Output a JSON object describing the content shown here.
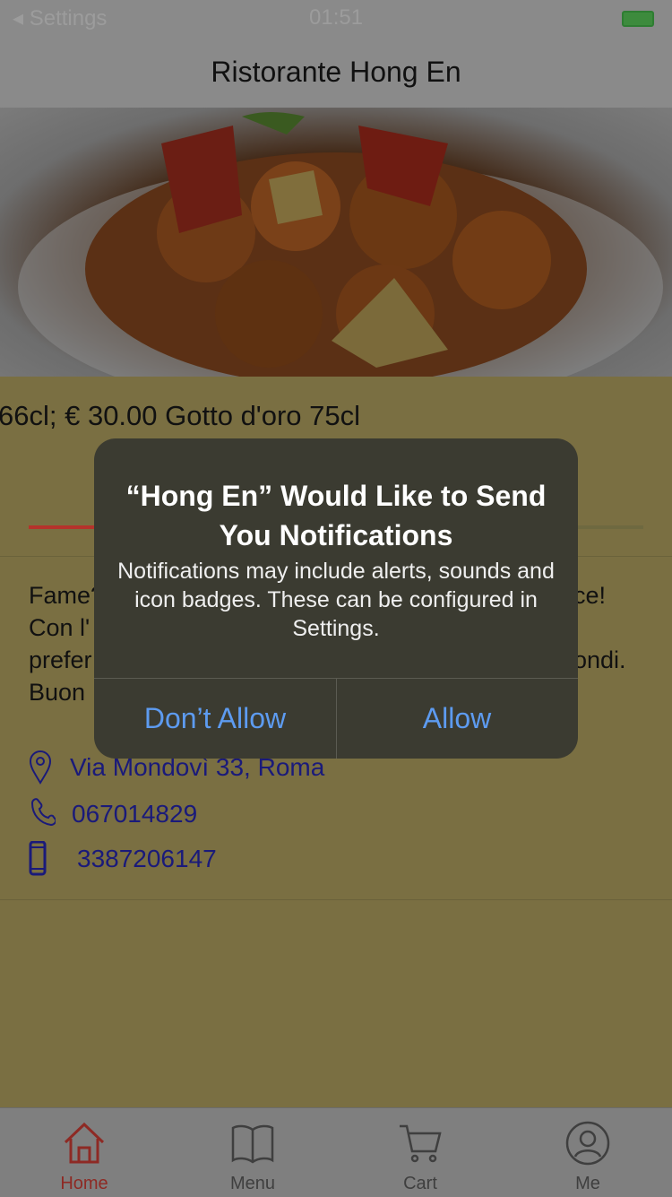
{
  "status_bar": {
    "back_label": "◂ Settings",
    "time": "01:51"
  },
  "nav": {
    "title": "Ristorante Hong En"
  },
  "hero": {
    "pager_count": 3,
    "active_index": 0
  },
  "content": {
    "price_line": "66cl; € 30.00 Gotto d'oro 75cl",
    "description_left": [
      "Fame?",
      "Con l'",
      "prefer",
      "Buon"
    ],
    "description_right": [
      "ce!",
      "",
      "ondi.",
      ""
    ]
  },
  "contact": {
    "address": "Via Mondovì 33, Roma",
    "phone": "067014829",
    "mobile": "3387206147"
  },
  "tabs": [
    {
      "label": "Home",
      "active": true
    },
    {
      "label": "Menu",
      "active": false
    },
    {
      "label": "Cart",
      "active": false
    },
    {
      "label": "Me",
      "active": false
    }
  ],
  "alert": {
    "title": "“Hong En” Would Like to Send You Notifications",
    "message": "Notifications may include alerts, sounds and icon badges. These can be configured in Settings.",
    "deny_label": "Don’t Allow",
    "allow_label": "Allow"
  },
  "colors": {
    "accent_red": "#8e2a24",
    "link_blue": "#5d9bf0",
    "contact_blue": "#1a1a7a"
  }
}
